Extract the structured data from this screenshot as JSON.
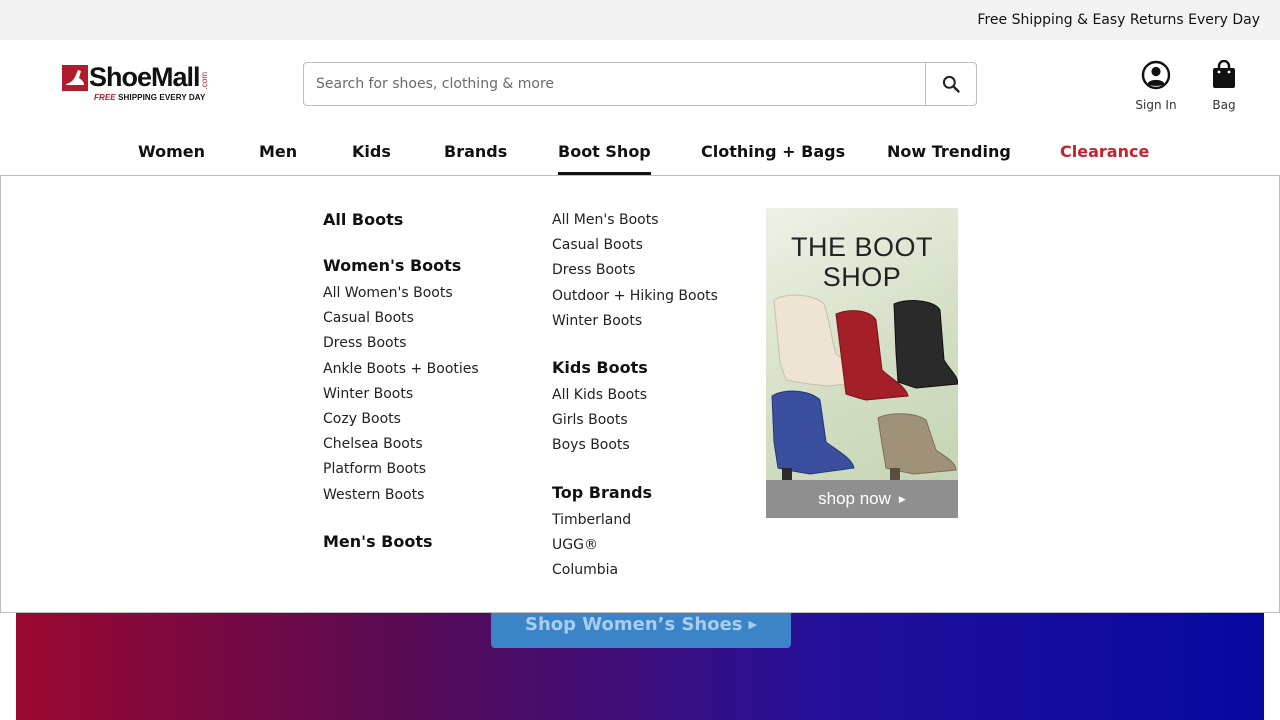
{
  "promo": {
    "text": "Free Shipping & Easy Returns Every Day"
  },
  "logo": {
    "name": "ShoeMall",
    "com": ".com",
    "tag_free": "FREE",
    "tag_rest": " SHIPPING EVERY DAY"
  },
  "search": {
    "placeholder": "Search for shoes, clothing & more",
    "value": ""
  },
  "account": {
    "sign_in": "Sign In",
    "bag": "Bag"
  },
  "nav": {
    "items": [
      "Women",
      "Men",
      "Kids",
      "Brands",
      "Boot Shop",
      "Clothing + Bags",
      "Now Trending",
      "Clearance"
    ],
    "active": "Boot Shop",
    "sale_color": "#c8202d"
  },
  "menu": {
    "col1": {
      "all": "All Boots",
      "womens_head": "Women's Boots",
      "womens": [
        "All Women's Boots",
        "Casual Boots",
        "Dress Boots",
        "Ankle Boots + Booties",
        "Winter Boots",
        "Cozy Boots",
        "Chelsea Boots",
        "Platform Boots",
        "Western Boots"
      ],
      "mens_head": "Men's Boots"
    },
    "col2": {
      "mens": [
        "All Men's Boots",
        "Casual Boots",
        "Dress Boots",
        "Outdoor + Hiking Boots",
        "Winter Boots"
      ],
      "kids_head": "Kids Boots",
      "kids": [
        "All Kids Boots",
        "Girls Boots",
        "Boys Boots"
      ],
      "brands_head": "Top Brands",
      "brands": [
        "Timberland",
        "UGG®",
        "Columbia"
      ]
    },
    "tile": {
      "title_line1": "THE BOOT",
      "title_line2": "SHOP",
      "cta": "shop now"
    }
  },
  "hero": {
    "button": "Shop Women’s Shoes"
  }
}
